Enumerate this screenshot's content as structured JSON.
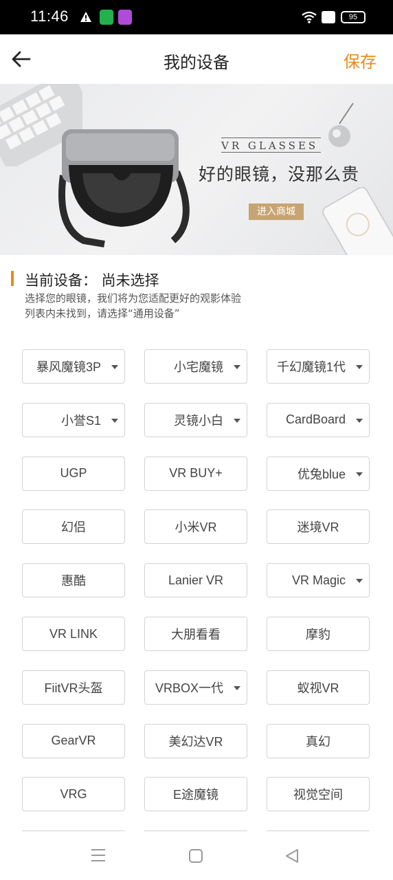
{
  "status_bar": {
    "time": "11:46",
    "battery": "95"
  },
  "nav": {
    "title": "我的设备",
    "save_label": "保存"
  },
  "banner": {
    "tag": "VR GLASSES",
    "slogan": "好的眼镜，没那么贵",
    "shop_button": "进入商城"
  },
  "current_device": {
    "title": "当前设备：  尚未选择",
    "hint_1": "选择您的眼镜，我们将为您适配更好的观影体验",
    "hint_2": "列表内未找到，请选择“通用设备”"
  },
  "devices": [
    {
      "label": "暴风魔镜3P",
      "dropdown": true
    },
    {
      "label": "小宅魔镜",
      "dropdown": true
    },
    {
      "label": "千幻魔镜1代",
      "dropdown": true
    },
    {
      "label": "小誉S1",
      "dropdown": true
    },
    {
      "label": "灵镜小白",
      "dropdown": true
    },
    {
      "label": "CardBoard",
      "dropdown": true
    },
    {
      "label": "UGP",
      "dropdown": false
    },
    {
      "label": "VR BUY+",
      "dropdown": false
    },
    {
      "label": "优兔blue",
      "dropdown": true
    },
    {
      "label": "幻侣",
      "dropdown": false
    },
    {
      "label": "小米VR",
      "dropdown": false
    },
    {
      "label": "迷境VR",
      "dropdown": false
    },
    {
      "label": "惠酷",
      "dropdown": false
    },
    {
      "label": "Lanier VR",
      "dropdown": false
    },
    {
      "label": "VR Magic",
      "dropdown": true
    },
    {
      "label": "VR LINK",
      "dropdown": false
    },
    {
      "label": "大朋看看",
      "dropdown": false
    },
    {
      "label": "摩豹",
      "dropdown": false
    },
    {
      "label": "FiitVR头盔",
      "dropdown": false
    },
    {
      "label": "VRBOX一代",
      "dropdown": true
    },
    {
      "label": "蚁视VR",
      "dropdown": false
    },
    {
      "label": "GearVR",
      "dropdown": false
    },
    {
      "label": "美幻达VR",
      "dropdown": false
    },
    {
      "label": "真幻",
      "dropdown": false
    },
    {
      "label": "VRG",
      "dropdown": false
    },
    {
      "label": "E途魔镜",
      "dropdown": false
    },
    {
      "label": "视觉空间",
      "dropdown": false
    }
  ],
  "colors": {
    "accent": "#e88a1e",
    "shop_button": "#c7a473"
  },
  "icons": [
    "back-arrow-icon",
    "menu-icon",
    "home-icon",
    "back-triangle-icon"
  ]
}
